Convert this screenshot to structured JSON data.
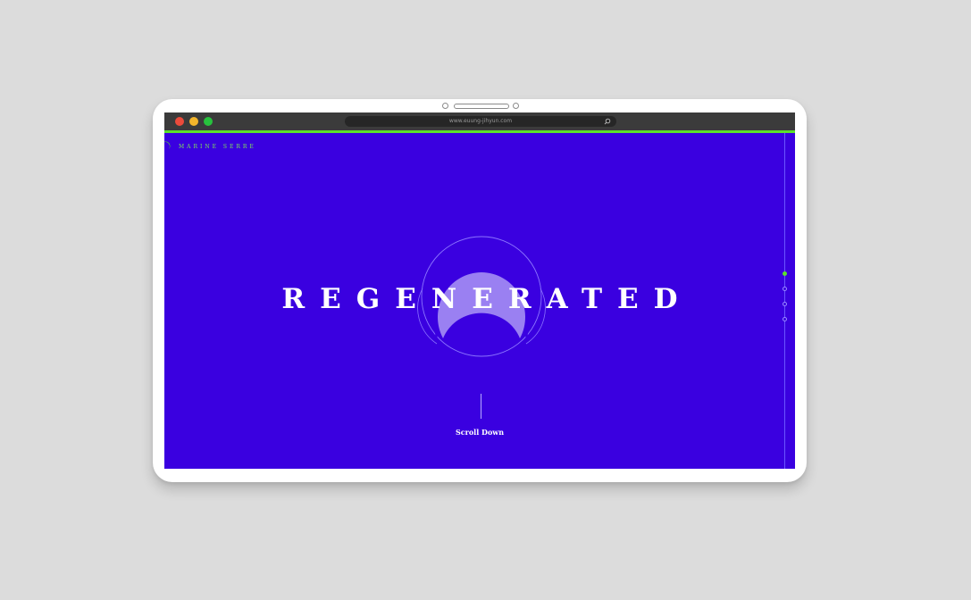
{
  "browser": {
    "url": "www.euung-jihyun.com",
    "traffic_lights": [
      "#ec4b3b",
      "#f3b52b",
      "#27c23d"
    ]
  },
  "site": {
    "brand": "MARINE SERRE",
    "hero_title": "REGENERATED",
    "scroll_label": "Scroll Down",
    "colors": {
      "background": "#3a00e0",
      "accent": "#5ce02c",
      "moon": "#9a80f2"
    },
    "nav_dots": [
      {
        "active": true
      },
      {
        "active": false
      },
      {
        "active": false
      },
      {
        "active": false
      }
    ]
  },
  "icons": {
    "logo": "crescent-moon-icon",
    "url_search": "search-icon"
  }
}
